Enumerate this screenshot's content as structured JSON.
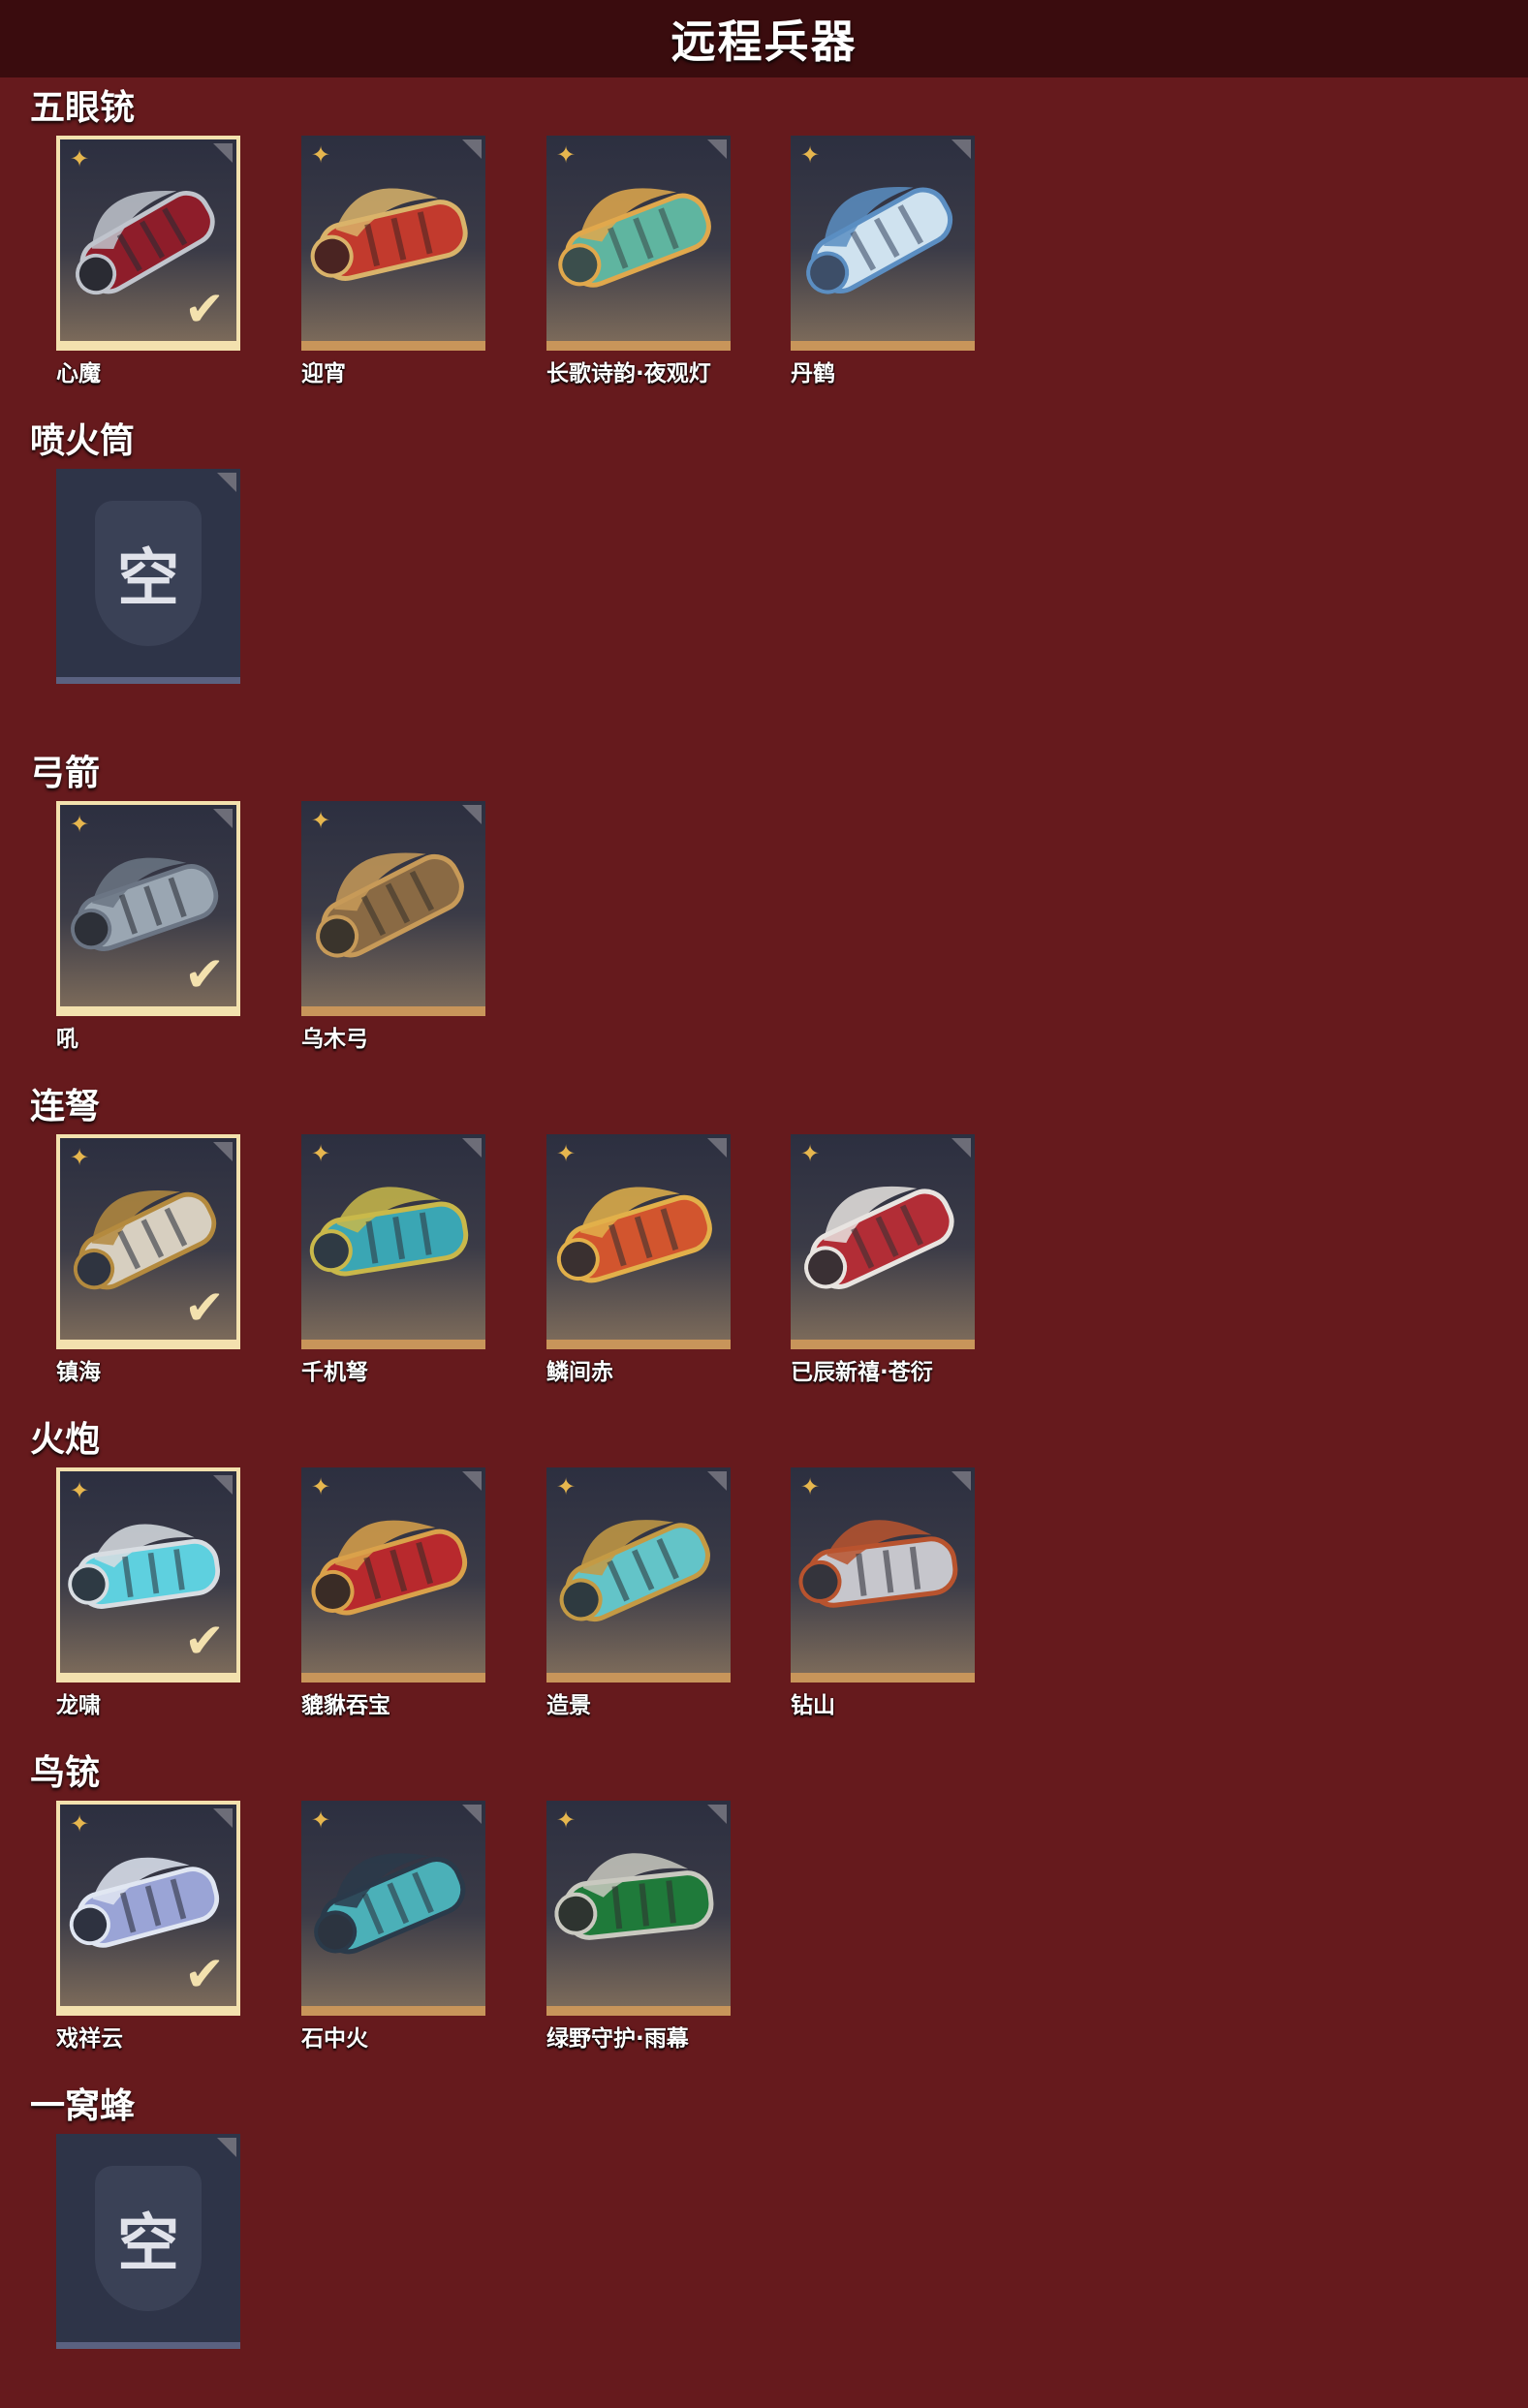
{
  "header": {
    "title": "远程兵器"
  },
  "sections": [
    {
      "title": "五眼铳",
      "items": [
        {
          "name": "心魔",
          "selected": true,
          "empty": false,
          "colors": [
            "#2a2b33",
            "#8e1d2a",
            "#c0c4cc"
          ]
        },
        {
          "name": "迎宵",
          "selected": false,
          "empty": false,
          "colors": [
            "#4a2422",
            "#c23a2d",
            "#d9b36a"
          ]
        },
        {
          "name": "长歌诗韵·夜观灯",
          "selected": false,
          "empty": false,
          "colors": [
            "#3b4e4c",
            "#5fb5a0",
            "#e0a84c"
          ]
        },
        {
          "name": "丹鹤",
          "selected": false,
          "empty": false,
          "colors": [
            "#3d4e68",
            "#cfe2ef",
            "#5b8ec2"
          ]
        }
      ]
    },
    {
      "title": "喷火筒",
      "items": [
        {
          "name": "",
          "selected": false,
          "empty": true,
          "empty_label": "空"
        }
      ]
    },
    {
      "title": "弓箭",
      "items": [
        {
          "name": "吼",
          "selected": true,
          "empty": false,
          "colors": [
            "#2d3038",
            "#9aa6b2",
            "#6b7584"
          ]
        },
        {
          "name": "乌木弓",
          "selected": false,
          "empty": false,
          "colors": [
            "#3a342c",
            "#8a6a44",
            "#c79a58"
          ]
        }
      ]
    },
    {
      "title": "连弩",
      "items": [
        {
          "name": "镇海",
          "selected": true,
          "empty": false,
          "colors": [
            "#2f3440",
            "#d7cfc0",
            "#b48a3e"
          ]
        },
        {
          "name": "千机弩",
          "selected": false,
          "empty": false,
          "colors": [
            "#2f3a44",
            "#3aa6b4",
            "#c9b84a"
          ]
        },
        {
          "name": "鳞间赤",
          "selected": false,
          "empty": false,
          "colors": [
            "#3a3030",
            "#d2552e",
            "#e2b04a"
          ]
        },
        {
          "name": "已辰新禧·苍衍",
          "selected": false,
          "empty": false,
          "colors": [
            "#3a3034",
            "#b22d36",
            "#e8e4e0"
          ]
        }
      ]
    },
    {
      "title": "火炮",
      "items": [
        {
          "name": "龙啸",
          "selected": true,
          "empty": false,
          "colors": [
            "#2e3a44",
            "#5ed0df",
            "#d8dde2"
          ]
        },
        {
          "name": "貔貅吞宝",
          "selected": false,
          "empty": false,
          "colors": [
            "#3a2c26",
            "#b8292d",
            "#d9a14a"
          ]
        },
        {
          "name": "造景",
          "selected": false,
          "empty": false,
          "colors": [
            "#2e3a40",
            "#63c4c8",
            "#c49a44"
          ]
        },
        {
          "name": "钻山",
          "selected": false,
          "empty": false,
          "colors": [
            "#34343c",
            "#c6c6cc",
            "#b8532e"
          ]
        }
      ]
    },
    {
      "title": "鸟铳",
      "items": [
        {
          "name": "戏祥云",
          "selected": true,
          "empty": false,
          "colors": [
            "#2e3240",
            "#9aa4d6",
            "#e0e6f2"
          ]
        },
        {
          "name": "石中火",
          "selected": false,
          "empty": false,
          "colors": [
            "#2c3440",
            "#4bb0b8",
            "#2a3a4a"
          ]
        },
        {
          "name": "绿野守护·雨幕",
          "selected": false,
          "empty": false,
          "colors": [
            "#2e3430",
            "#1f7a3a",
            "#c9c9c0"
          ]
        }
      ]
    },
    {
      "title": "一窝蜂",
      "items": [
        {
          "name": "",
          "selected": false,
          "empty": true,
          "empty_label": "空"
        }
      ]
    }
  ]
}
